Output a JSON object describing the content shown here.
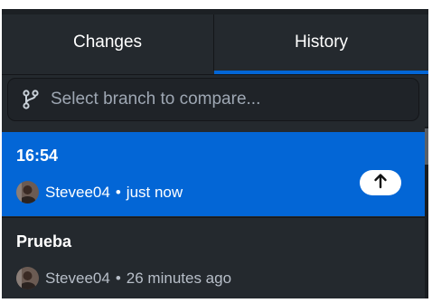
{
  "tabs": [
    {
      "label": "Changes",
      "active": false
    },
    {
      "label": "History",
      "active": true
    }
  ],
  "branch_compare": {
    "placeholder": "Select branch to compare...",
    "icon": "git-branch-icon"
  },
  "commits": [
    {
      "title": "16:54",
      "author": "Stevee04",
      "separator": "•",
      "time": "just now",
      "selected": true,
      "push_indicator_icon": "arrow-up-icon"
    },
    {
      "title": "Prueba",
      "author": "Stevee04",
      "separator": "•",
      "time": "26 minutes ago",
      "selected": false
    }
  ],
  "colors": {
    "panel_bg": "#24292e",
    "accent": "#0366d6",
    "text": "#ffffff",
    "muted_text": "#b7bec8"
  }
}
